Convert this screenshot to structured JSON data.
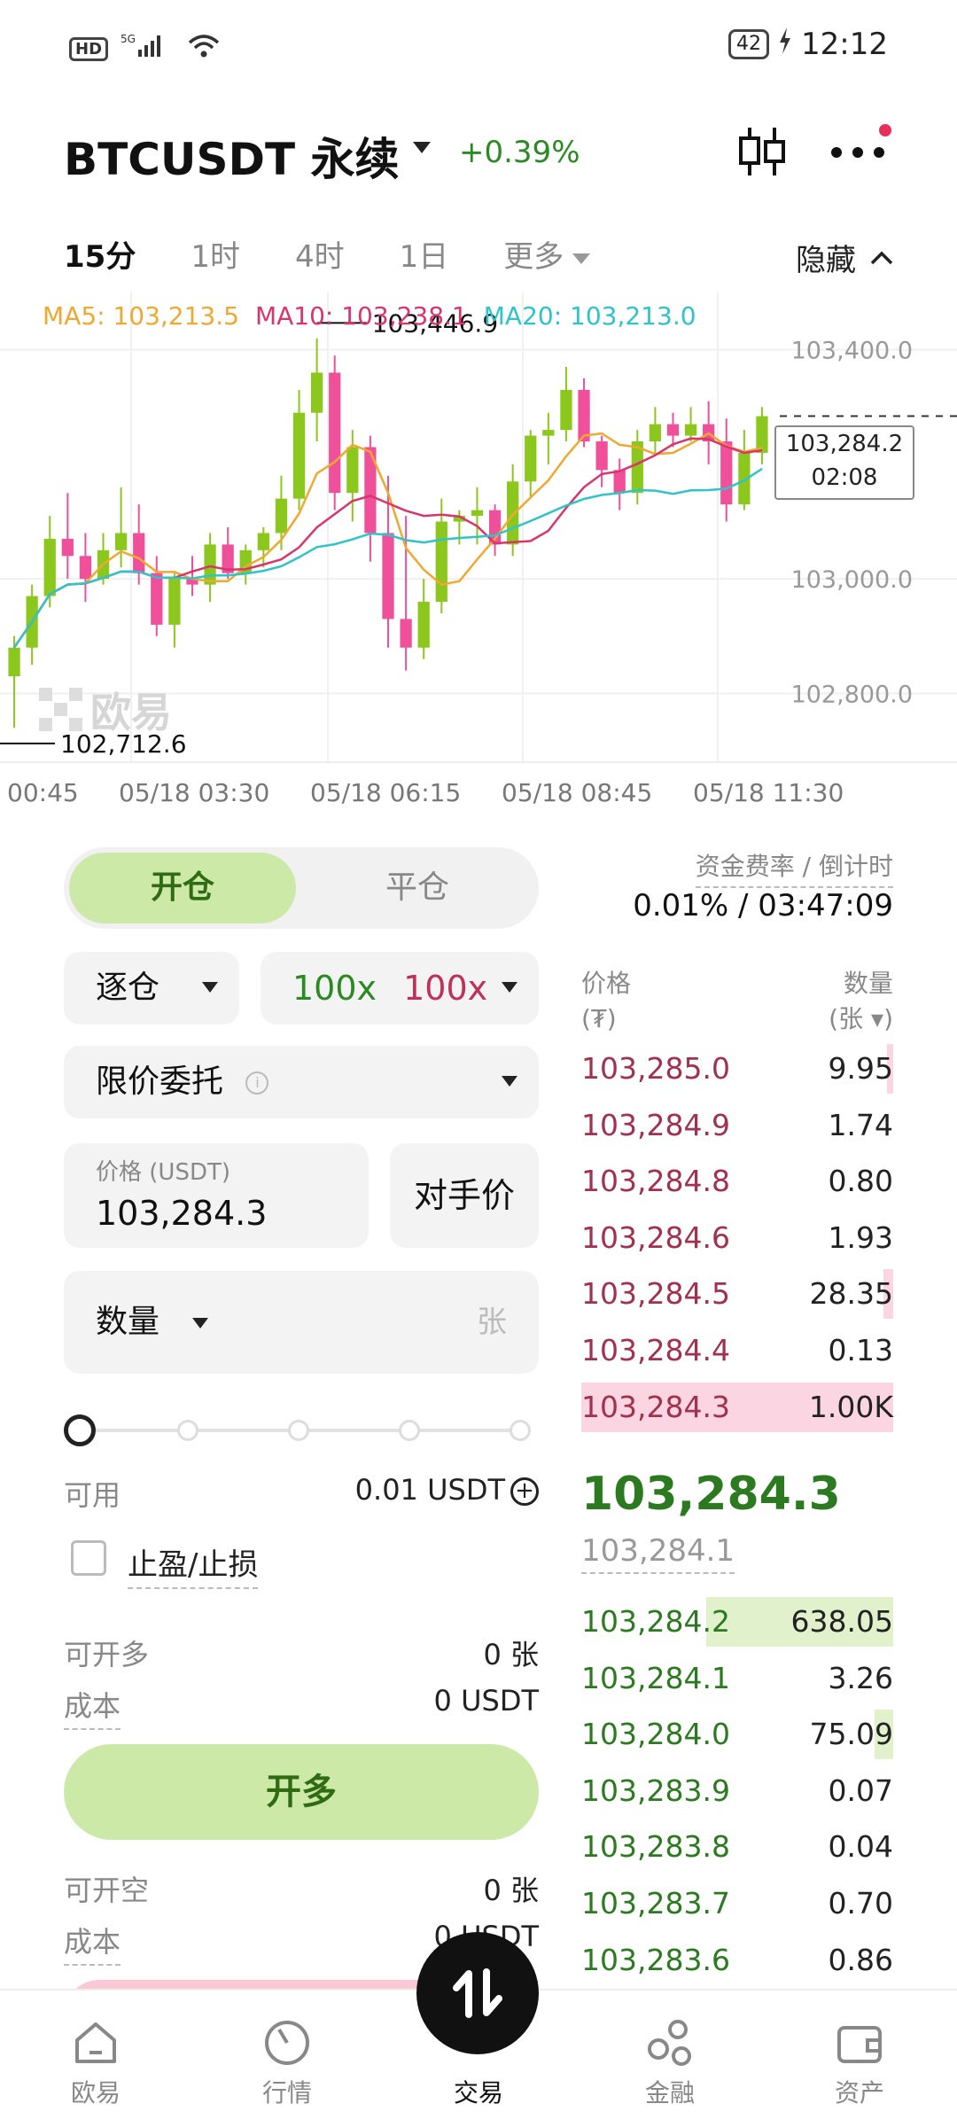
{
  "status_bar": {
    "hd": "HD",
    "signal": "5G",
    "battery": "42",
    "time": "12:12"
  },
  "header": {
    "title": "BTCUSDT 永续",
    "change": "+0.39%"
  },
  "intervals": {
    "items": [
      "15分",
      "1时",
      "4时",
      "1日",
      "更多"
    ],
    "active": "15分",
    "hide_label": "隐藏"
  },
  "chart": {
    "ma_legend": {
      "ma5": "MA5: 103,213.5",
      "ma10": "MA10: 103,238.1",
      "ma20": "MA20: 103,213.0"
    },
    "high_label": "103,446.9",
    "low_label": "102,712.6",
    "current_price_tag": "103,284.2",
    "countdown_tag": "02:08",
    "watermark": "欧易",
    "colors": {
      "up": "#8cc71e",
      "down": "#f0509a",
      "ma5": "#f0a830",
      "ma10": "#d9356c",
      "ma20": "#2ec4c8"
    }
  },
  "chart_data": {
    "type": "candlestick",
    "y_ticks": [
      "103,400.0",
      "103,000.0",
      "102,800.0"
    ],
    "y_tick_values": [
      103400,
      103000,
      102800
    ],
    "ylim": [
      102680,
      103500
    ],
    "x_ticks": [
      "00:45",
      "05/18 03:30",
      "05/18 06:15",
      "05/18 08:45",
      "05/18 11:30"
    ],
    "high": 103446.9,
    "low": 102712.6,
    "last": 103284.2,
    "candles": [
      [
        102830,
        102880,
        102740,
        102900
      ],
      [
        102880,
        102970,
        102850,
        102990
      ],
      [
        102970,
        103070,
        102950,
        103110
      ],
      [
        103070,
        103040,
        103000,
        103150
      ],
      [
        103040,
        103000,
        102960,
        103080
      ],
      [
        103000,
        103050,
        102990,
        103080
      ],
      [
        103050,
        103080,
        103020,
        103160
      ],
      [
        103080,
        103010,
        102990,
        103130
      ],
      [
        103010,
        102920,
        102900,
        103040
      ],
      [
        102920,
        103000,
        102880,
        103010
      ],
      [
        103000,
        102990,
        102970,
        103040
      ],
      [
        102990,
        103060,
        102960,
        103080
      ],
      [
        103060,
        103010,
        103000,
        103090
      ],
      [
        103010,
        103050,
        102990,
        103060
      ],
      [
        103050,
        103080,
        103020,
        103090
      ],
      [
        103080,
        103140,
        103050,
        103180
      ],
      [
        103140,
        103290,
        103120,
        103330
      ],
      [
        103290,
        103360,
        103240,
        103420
      ],
      [
        103360,
        103150,
        103120,
        103390
      ],
      [
        103150,
        103230,
        103100,
        103260
      ],
      [
        103230,
        103080,
        103030,
        103250
      ],
      [
        103080,
        102930,
        102880,
        103180
      ],
      [
        102930,
        102880,
        102840,
        103110
      ],
      [
        102880,
        102960,
        102860,
        103000
      ],
      [
        102960,
        103100,
        102940,
        103140
      ],
      [
        103100,
        103110,
        103060,
        103120
      ],
      [
        103110,
        103120,
        103060,
        103160
      ],
      [
        103120,
        103060,
        103040,
        103130
      ],
      [
        103060,
        103170,
        103040,
        103200
      ],
      [
        103170,
        103250,
        103140,
        103260
      ],
      [
        103250,
        103260,
        103200,
        103290
      ],
      [
        103260,
        103330,
        103240,
        103370
      ],
      [
        103330,
        103240,
        103230,
        103350
      ],
      [
        103240,
        103190,
        103160,
        103250
      ],
      [
        103190,
        103150,
        103120,
        103210
      ],
      [
        103150,
        103240,
        103130,
        103260
      ],
      [
        103240,
        103270,
        103220,
        103300
      ],
      [
        103270,
        103250,
        103230,
        103290
      ],
      [
        103250,
        103270,
        103240,
        103300
      ],
      [
        103270,
        103240,
        103200,
        103310
      ],
      [
        103240,
        103130,
        103100,
        103280
      ],
      [
        103130,
        103220,
        103120,
        103260
      ],
      [
        103220,
        103284,
        103200,
        103300
      ]
    ]
  },
  "trade_panel": {
    "tab_open": "开仓",
    "tab_close": "平仓",
    "margin_mode": "逐仓",
    "leverage_long": "100x",
    "leverage_short": "100x",
    "order_type": "限价委托",
    "price_label": "价格 (USDT)",
    "price_value": "103,284.3",
    "opp_price": "对手价",
    "qty_label": "数量",
    "qty_unit": "张",
    "available_label": "可用",
    "available_value": "0.01 USDT",
    "tpsl_label": "止盈/止损",
    "can_long_label": "可开多",
    "can_long_value": "0 张",
    "cost_label": "成本",
    "cost_value": "0 USDT",
    "open_long": "开多",
    "can_short_label": "可开空",
    "can_short_value": "0 张",
    "cost2_label": "成本",
    "cost2_value": "0 USDT"
  },
  "funding": {
    "label": "资金费率 / 倒计时",
    "value": "0.01% / 03:47:09"
  },
  "orderbook": {
    "price_header": "价格",
    "price_unit": "(₮)",
    "qty_header": "数量",
    "qty_unit": "(张",
    "asks": [
      {
        "price": "103,285.0",
        "qty": "9.95",
        "depth": 0.02
      },
      {
        "price": "103,284.9",
        "qty": "1.74",
        "depth": 0.0
      },
      {
        "price": "103,284.8",
        "qty": "0.80",
        "depth": 0.0
      },
      {
        "price": "103,284.6",
        "qty": "1.93",
        "depth": 0.0
      },
      {
        "price": "103,284.5",
        "qty": "28.35",
        "depth": 0.03
      },
      {
        "price": "103,284.4",
        "qty": "0.13",
        "depth": 0.0
      },
      {
        "price": "103,284.3",
        "qty": "1.00K",
        "depth": 1.0
      }
    ],
    "last_price": "103,284.3",
    "mark_price": "103,284.1",
    "bids": [
      {
        "price": "103,284.2",
        "qty": "638.05",
        "depth": 0.6
      },
      {
        "price": "103,284.1",
        "qty": "3.26",
        "depth": 0.0
      },
      {
        "price": "103,284.0",
        "qty": "75.09",
        "depth": 0.06
      },
      {
        "price": "103,283.9",
        "qty": "0.07",
        "depth": 0.0
      },
      {
        "price": "103,283.8",
        "qty": "0.04",
        "depth": 0.0
      },
      {
        "price": "103,283.7",
        "qty": "0.70",
        "depth": 0.0
      },
      {
        "price": "103,283.6",
        "qty": "0.86",
        "depth": 0.0
      }
    ]
  },
  "nav": {
    "items": [
      "欧易",
      "行情",
      "交易",
      "金融",
      "资产"
    ],
    "active": "交易"
  }
}
